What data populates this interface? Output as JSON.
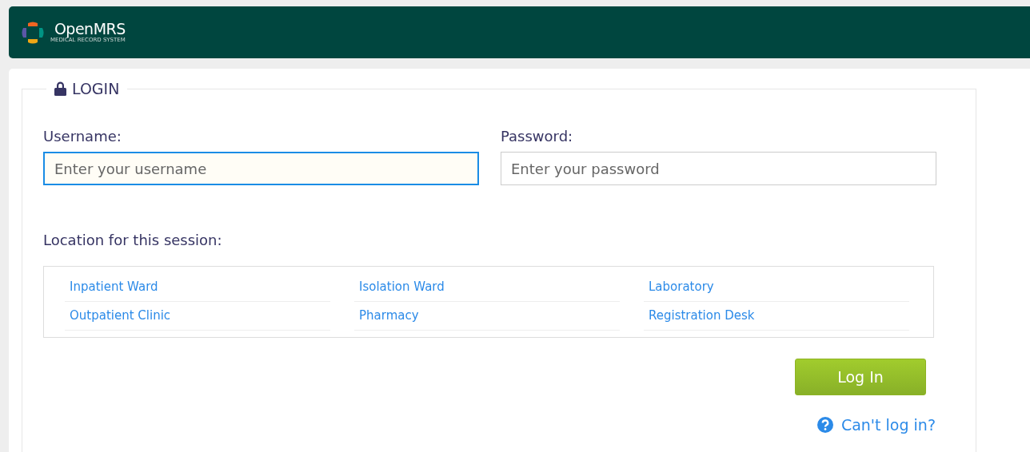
{
  "header": {
    "logo_text": "OpenMRS",
    "logo_tagline": "MEDICAL RECORD SYSTEM"
  },
  "login": {
    "legend": "LOGIN",
    "fields": [
      {
        "label": "Username:",
        "placeholder": "Enter your username",
        "focused": true
      },
      {
        "label": "Password:",
        "placeholder": "Enter your password",
        "focused": false
      }
    ],
    "location_label": "Location for this session:",
    "locations": [
      {
        "name": "Inpatient Ward",
        "selected": false
      },
      {
        "name": "Isolation Ward",
        "selected": false
      },
      {
        "name": "Laboratory",
        "selected": false
      },
      {
        "name": "Outpatient Clinic",
        "selected": false
      },
      {
        "name": "Pharmacy",
        "selected": false
      },
      {
        "name": "Registration Desk",
        "selected": false
      }
    ],
    "submit": "Log In",
    "help_link": "Can't log in?"
  }
}
